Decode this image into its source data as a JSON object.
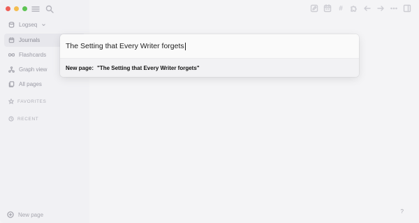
{
  "sidebar": {
    "graph_name": "Logseq",
    "items": [
      {
        "label": "Journals",
        "icon": "calendar-icon",
        "active": true
      },
      {
        "label": "Flashcards",
        "icon": "infinity-icon",
        "active": false
      },
      {
        "label": "Graph view",
        "icon": "graph-icon",
        "active": false
      },
      {
        "label": "All pages",
        "icon": "pages-icon",
        "active": false
      }
    ],
    "sections": {
      "favorites": "FAVORITES",
      "recent": "RECENT"
    },
    "new_page_label": "New page"
  },
  "search": {
    "query": "The Setting that Every Writer forgets",
    "result_label": "New page:",
    "result_value": "\"The Setting that Every Writer forgets\""
  },
  "help_label": "?",
  "colors": {
    "traffic_red": "#ee5f57",
    "traffic_yellow": "#f4bd4f",
    "traffic_green": "#5ec454",
    "background": "#f4f4f6"
  }
}
